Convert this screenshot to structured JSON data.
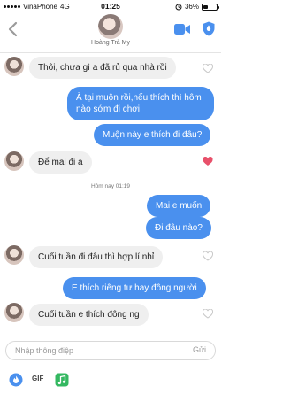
{
  "status_bar": {
    "carrier": "VinaPhone",
    "network": "4G",
    "time": "01:25",
    "battery": "36%",
    "battery_level": 0.36
  },
  "header": {
    "contact_name": "Hoàng Trà My"
  },
  "messages": [
    {
      "id": "m1",
      "side": "in",
      "text": "Thôi, chưa gì a đã rủ qua nhà rồi",
      "liked": false
    },
    {
      "id": "m2",
      "side": "out",
      "lines": [
        "À tại muộn rồi,nếu thích thì hôm",
        "nào sớm đi chơi"
      ]
    },
    {
      "id": "m3",
      "side": "out",
      "text": "Muộn này e thích đi đâu?"
    },
    {
      "id": "m4",
      "side": "in",
      "text": "Để mai đi a",
      "liked": true
    },
    {
      "id": "ts",
      "type": "timestamp",
      "day": "Hôm nay",
      "time": "01:19"
    },
    {
      "id": "m5",
      "side": "out",
      "text": "Mai e muốn"
    },
    {
      "id": "m6",
      "side": "out",
      "text": "Đi đâu nào?"
    },
    {
      "id": "m7",
      "side": "in",
      "text": "Cuối tuần đi đâu thì hợp lí nhỉ",
      "liked": false
    },
    {
      "id": "m8",
      "side": "out",
      "text": "E thích riêng tư hay đông người"
    },
    {
      "id": "m9",
      "side": "in",
      "text": "Cuối tuần e thích đông ng",
      "liked": false
    }
  ],
  "composer": {
    "placeholder": "Nhập thông điệp",
    "send_label": "Gửi"
  },
  "toolbar": {
    "gif_label": "GIF",
    "icons": [
      "tinder-gold-icon",
      "gif-icon",
      "music-icon"
    ]
  },
  "colors": {
    "accent": "#4a90ee",
    "incoming_bubble": "#efefef",
    "heart_liked": "#e8506a",
    "heart_empty": "#c9c9c9"
  }
}
